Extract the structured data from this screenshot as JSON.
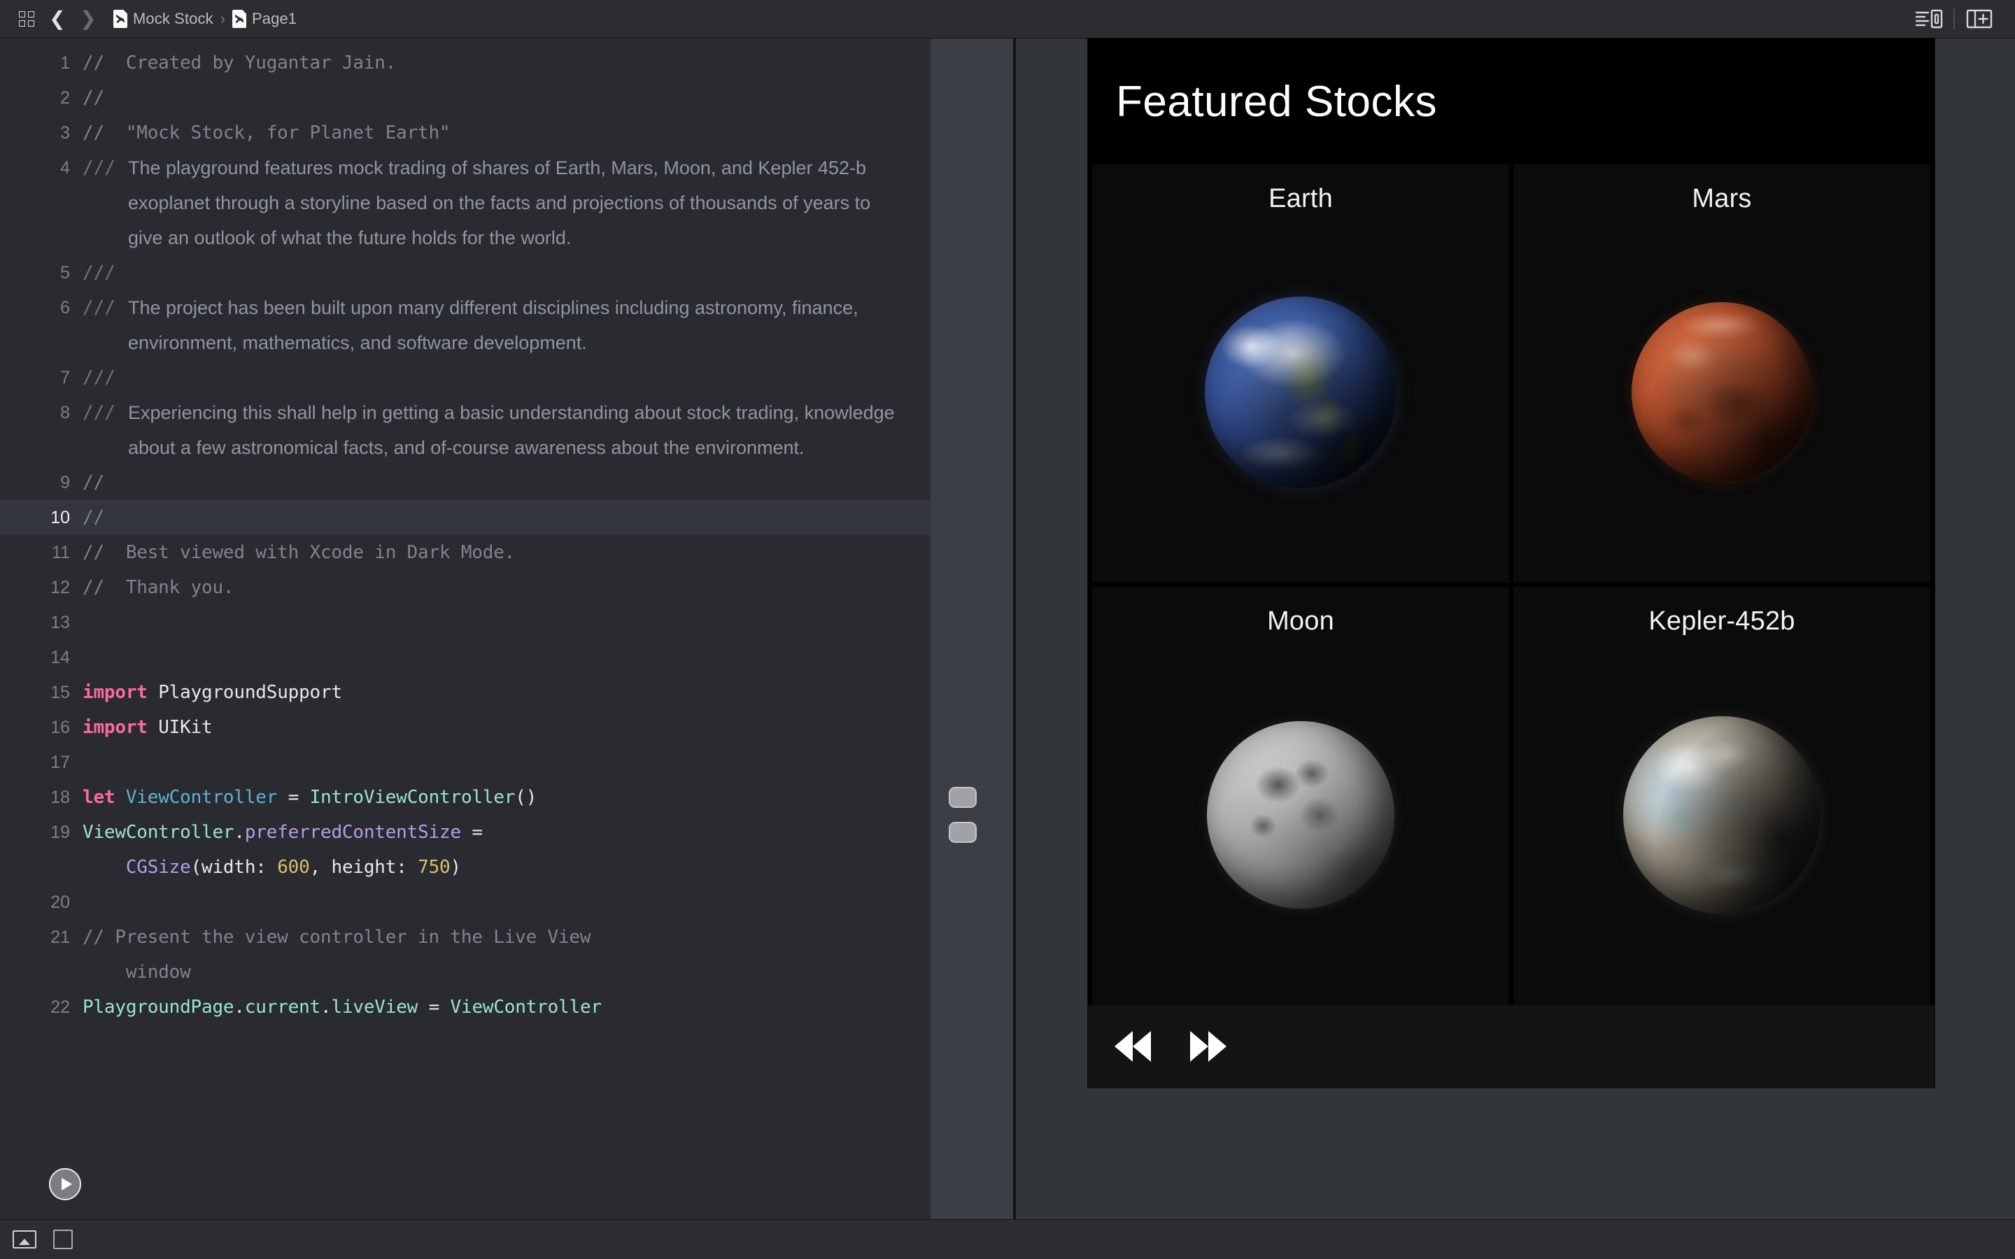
{
  "toolbar": {
    "navigator_icon": "grid-icon",
    "back_icon": "chevron-left-icon",
    "forward_icon": "chevron-right-icon",
    "breadcrumb": {
      "project_label": "Mock Stock",
      "separator": "›",
      "page_label": "Page1",
      "file_icon": "swift-file-icon"
    },
    "right_icons": [
      {
        "name": "editor-options-icon",
        "label": "Editor Options"
      },
      {
        "name": "add-editor-icon",
        "label": "Add Editor"
      }
    ]
  },
  "editor": {
    "current_line": 10,
    "run_button_label": "Run",
    "lines": [
      {
        "n": "1",
        "type": "code",
        "html": "<span class='cmt'>//  Created by Yugantar Jain.</span>"
      },
      {
        "n": "2",
        "type": "code",
        "html": "<span class='cmt'>//</span>"
      },
      {
        "n": "3",
        "type": "code",
        "html": "<span class='cmt'>//  \"Mock Stock, for Planet Earth\"</span>"
      },
      {
        "n": "4",
        "type": "doc",
        "slashes": "///",
        "body": "The playground features mock trading of shares of Earth, Mars, Moon, and Kepler 452-b exoplanet through a storyline based on the facts and projections of thousands of years to give an outlook of what the future holds for the world."
      },
      {
        "n": "5",
        "type": "doc",
        "slashes": "///",
        "body": ""
      },
      {
        "n": "6",
        "type": "doc",
        "slashes": "///",
        "body": "The project has been built upon many different disciplines including astronomy, finance, environment, mathematics, and software development."
      },
      {
        "n": "7",
        "type": "doc",
        "slashes": "///",
        "body": ""
      },
      {
        "n": "8",
        "type": "doc",
        "slashes": "///",
        "body": "Experiencing this shall help in getting a basic understanding about stock trading, knowledge about a few astronomical facts, and of-course awareness about the environment."
      },
      {
        "n": "9",
        "type": "code",
        "html": "<span class='cmt'>//</span>"
      },
      {
        "n": "10",
        "type": "code",
        "html": "<span class='cmt'>//</span>"
      },
      {
        "n": "11",
        "type": "code",
        "html": "<span class='cmt'>//  Best viewed with Xcode in Dark Mode.</span>"
      },
      {
        "n": "12",
        "type": "code",
        "html": "<span class='cmt'>//  Thank you.</span>"
      },
      {
        "n": "13",
        "type": "code",
        "html": ""
      },
      {
        "n": "14",
        "type": "code",
        "html": ""
      },
      {
        "n": "15",
        "type": "code",
        "html": "<span class='kw'>import</span> <span class='pln'>PlaygroundSupport</span>"
      },
      {
        "n": "16",
        "type": "code",
        "html": "<span class='kw'>import</span> <span class='pln'>UIKit</span>"
      },
      {
        "n": "17",
        "type": "code",
        "html": ""
      },
      {
        "n": "18",
        "type": "code",
        "html": "<span class='kw'>let</span> <span class='cls'>ViewController</span> <span class='pln'>=</span> <span class='typ'>IntroViewController</span><span class='pln'>()</span>"
      },
      {
        "n": "19",
        "type": "code",
        "html": "<span class='typ'>ViewController</span><span class='pln'>.</span><span class='prop'>preferredContentSize</span> <span class='pln'>=</span>\n    <span class='prop'>CGSize</span><span class='pln'>(width: </span><span class='num'>600</span><span class='pln'>, height: </span><span class='num'>750</span><span class='pln'>)</span>"
      },
      {
        "n": "20",
        "type": "code",
        "html": ""
      },
      {
        "n": "21",
        "type": "code",
        "html": "<span class='cmt'>// Present the view controller in the Live View\n    window</span>"
      },
      {
        "n": "22",
        "type": "code",
        "html": "<span class='typ'>PlaygroundPage</span><span class='pln'>.</span><span class='typ'>current</span><span class='pln'>.</span><span class='typ'>liveView</span> <span class='pln'>=</span> <span class='typ'>ViewController</span>"
      }
    ]
  },
  "results_sidebar": {
    "badges": [
      {
        "name": "value-history-badge",
        "line": "18"
      },
      {
        "name": "value-history-badge",
        "line": "19"
      }
    ]
  },
  "live_view": {
    "title": "Featured Stocks",
    "cards": [
      {
        "name": "Earth",
        "planet_class": "earth"
      },
      {
        "name": "Mars",
        "planet_class": "mars"
      },
      {
        "name": "Moon",
        "planet_class": "moon"
      },
      {
        "name": "Kepler-452b",
        "planet_class": "kepler"
      }
    ],
    "controls": [
      {
        "name": "rewind-button",
        "icon": "rewind-icon"
      },
      {
        "name": "fast-forward-button",
        "icon": "fast-forward-icon"
      }
    ]
  },
  "status_bar": {
    "icons": [
      {
        "name": "show-debug-area-icon"
      },
      {
        "name": "hide-console-icon"
      }
    ]
  },
  "colors": {
    "editor_bg": "#292b30",
    "toolbar_bg": "#2b2d31",
    "current_line_bg": "#33363e",
    "keyword": "#fc6a9e",
    "type": "#9ae6c8",
    "class": "#5cb3d6",
    "property": "#b79bea",
    "number": "#d9c06a",
    "comment": "#7f848c",
    "liveview_bg": "#000000"
  }
}
